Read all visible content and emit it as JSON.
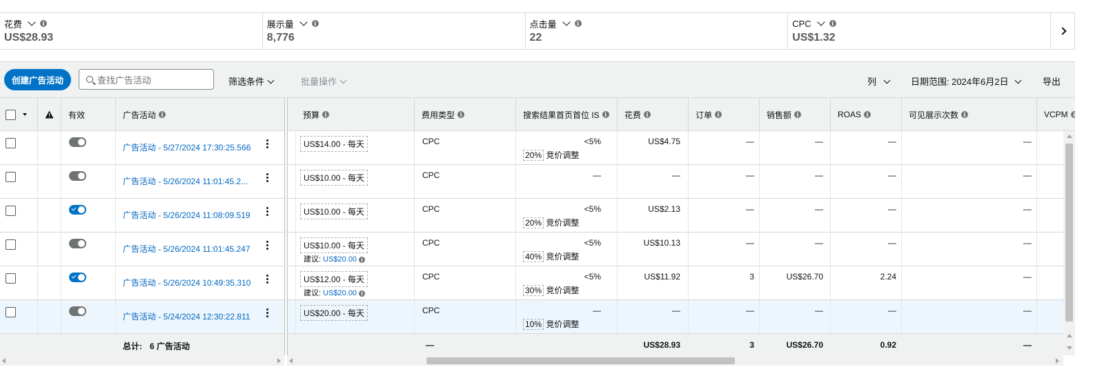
{
  "metrics": [
    {
      "label": "花费",
      "value": "US$28.93"
    },
    {
      "label": "展示量",
      "value": "8,776"
    },
    {
      "label": "点击量",
      "value": "22"
    },
    {
      "label": "CPC",
      "value": "US$1.32"
    }
  ],
  "toolbar": {
    "create_label": "创建广告活动",
    "search_placeholder": "查找广告活动",
    "filter_label": "筛选条件",
    "bulk_label": "批量操作",
    "columns_label": "列",
    "date_range_label": "日期范围: 2024年6月2日",
    "export_label": "导出"
  },
  "columns": {
    "active": "有效",
    "campaign": "广告活动",
    "budget": "预算",
    "cost_type": "费用类型",
    "top_of_search": "搜索结果首页首位 IS",
    "spend": "花费",
    "orders": "订单",
    "sales": "销售额",
    "roas": "ROAS",
    "viewable": "可见展示次数",
    "vcpm": "VCPM"
  },
  "rows": [
    {
      "active": false,
      "campaign": "广告活动 - 5/27/2024 17:30:25.566",
      "budget": "US$14.00 - 每天",
      "suggest": "",
      "cost_type": "CPC",
      "is": "<5%",
      "adj_pct": "20%",
      "adj_label": "竞价调整",
      "spend": "US$4.75",
      "orders": "—",
      "sales": "—",
      "roas": "—",
      "viewable": "—"
    },
    {
      "active": false,
      "campaign": "广告活动 - 5/26/2024 11:01:45.2...",
      "budget": "US$10.00 - 每天",
      "suggest": "",
      "cost_type": "CPC",
      "is": "—",
      "adj_pct": "",
      "adj_label": "",
      "spend": "—",
      "orders": "—",
      "sales": "—",
      "roas": "—",
      "viewable": "—"
    },
    {
      "active": true,
      "campaign": "广告活动 - 5/26/2024 11:08:09.519",
      "budget": "US$10.00 - 每天",
      "suggest": "",
      "cost_type": "CPC",
      "is": "<5%",
      "adj_pct": "20%",
      "adj_label": "竞价调整",
      "spend": "US$2.13",
      "orders": "—",
      "sales": "—",
      "roas": "—",
      "viewable": "—"
    },
    {
      "active": false,
      "campaign": "广告活动 - 5/26/2024 11:01:45.247",
      "budget": "US$10.00 - 每天",
      "suggest_label": "建议:",
      "suggest": "US$20.00",
      "cost_type": "CPC",
      "is": "<5%",
      "adj_pct": "40%",
      "adj_label": "竞价调整",
      "spend": "US$10.13",
      "orders": "—",
      "sales": "—",
      "roas": "—",
      "viewable": "—"
    },
    {
      "active": true,
      "campaign": "广告活动 - 5/26/2024 10:49:35.310",
      "budget": "US$12.00 - 每天",
      "suggest_label": "建议:",
      "suggest": "US$20.00",
      "cost_type": "CPC",
      "is": "<5%",
      "adj_pct": "30%",
      "adj_label": "竞价调整",
      "spend": "US$11.92",
      "orders": "3",
      "sales": "US$26.70",
      "roas": "2.24",
      "viewable": "—"
    },
    {
      "active": false,
      "campaign": "广告活动 - 5/24/2024 12:30:22.811",
      "budget": "US$20.00 - 每天",
      "suggest": "",
      "cost_type": "CPC",
      "is": "—",
      "adj_pct": "10%",
      "adj_label": "竞价调整",
      "spend": "—",
      "orders": "—",
      "sales": "—",
      "roas": "—",
      "viewable": "—"
    }
  ],
  "total": {
    "label": "总计:",
    "count": "6 广告活动",
    "cost_type": "—",
    "spend": "US$28.93",
    "orders": "3",
    "sales": "US$26.70",
    "roas": "0.92",
    "viewable": "—"
  },
  "colors": {
    "accent": "#0073c7",
    "link": "#0066c0"
  }
}
